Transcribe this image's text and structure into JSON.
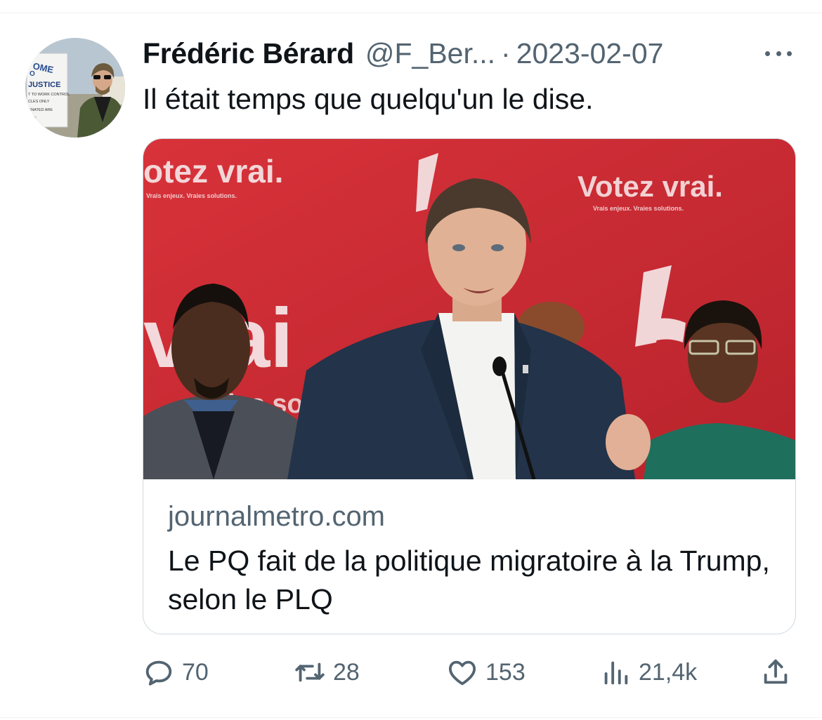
{
  "tweet": {
    "author_name": "Frédéric Bérard",
    "handle": "@F_Ber...",
    "separator": "·",
    "date": "2023-02-07",
    "text": "Il était temps que quelqu'un le dise."
  },
  "card": {
    "domain": "journalmetro.com",
    "title": "Le PQ fait de la politique migratoire à la Trump, selon le PLQ",
    "image_texts": {
      "banner_left": "otez vrai.",
      "banner_right": "Votez vrai.",
      "banner_center": "vrai",
      "sub_left": "Vrais enjeux. Vraies solutions.",
      "sub_right": "Vrais enjeux. Vraies solutions.",
      "bottom_fragment": "ies so"
    }
  },
  "avatar_texts": {
    "line1": "OME",
    "line2": "O",
    "line3": "JUSTICE",
    "line4": "T TO WORK CONTROL",
    "line5": "CLES ONLY",
    "line6": "GNATED ARE",
    "line7": "ONE"
  },
  "actions": {
    "reply_count": "70",
    "retweet_count": "28",
    "like_count": "153",
    "views_count": "21,4k"
  },
  "colors": {
    "text_primary": "#0f1419",
    "text_secondary": "#536471",
    "border": "#cfd9de",
    "banner_red": "#d42b34"
  },
  "icons": {
    "more": "more-icon",
    "reply": "reply-icon",
    "retweet": "retweet-icon",
    "like": "heart-icon",
    "views": "views-icon",
    "share": "share-icon"
  }
}
